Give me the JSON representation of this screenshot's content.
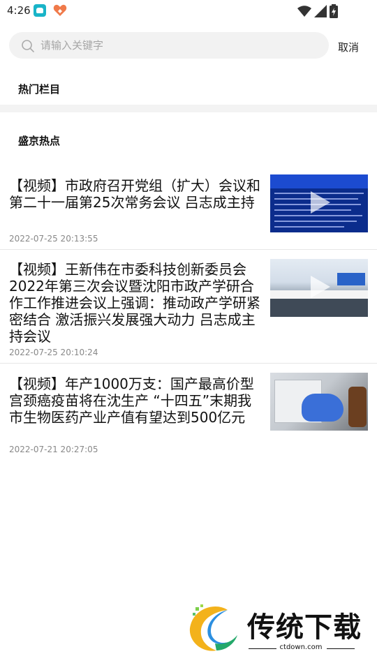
{
  "status_bar": {
    "time": "4:26",
    "icons": [
      "app-notification-icon",
      "app-heart-icon",
      "wifi-icon",
      "signal-icon",
      "battery-icon"
    ]
  },
  "search": {
    "placeholder": "请输入关键字",
    "value": "",
    "cancel_label": "取消"
  },
  "sections": {
    "hot_columns": "热门栏目",
    "hot_news": "盛京热点"
  },
  "news": [
    {
      "title": "【视频】市政府召开党组（扩大）会议和第二十一届第25次常务会议 吕志成主持",
      "time": "2022-07-25 20:13:55",
      "has_video": true
    },
    {
      "title": "【视频】王新伟在市委科技创新委员会2022年第三次会议暨沈阳市政产学研合作工作推进会议上强调：推动政产学研紧密结合 激活振兴发展强大动力 吕志成主持会议",
      "time": "2022-07-25 20:10:24",
      "has_video": true
    },
    {
      "title": "【视频】年产1000万支：国产最高价型宫颈癌疫苗将在沈生产 “十四五”末期我市生物医药产业产值有望达到500亿元",
      "time": "2022-07-21 20:27:05",
      "has_video": false
    }
  ],
  "watermark": {
    "brand": "传统下载",
    "site": "ctdown.com"
  },
  "colors": {
    "search_bg": "#f2f2f2",
    "divider": "#f3f3f3",
    "meta_text": "#888888"
  }
}
